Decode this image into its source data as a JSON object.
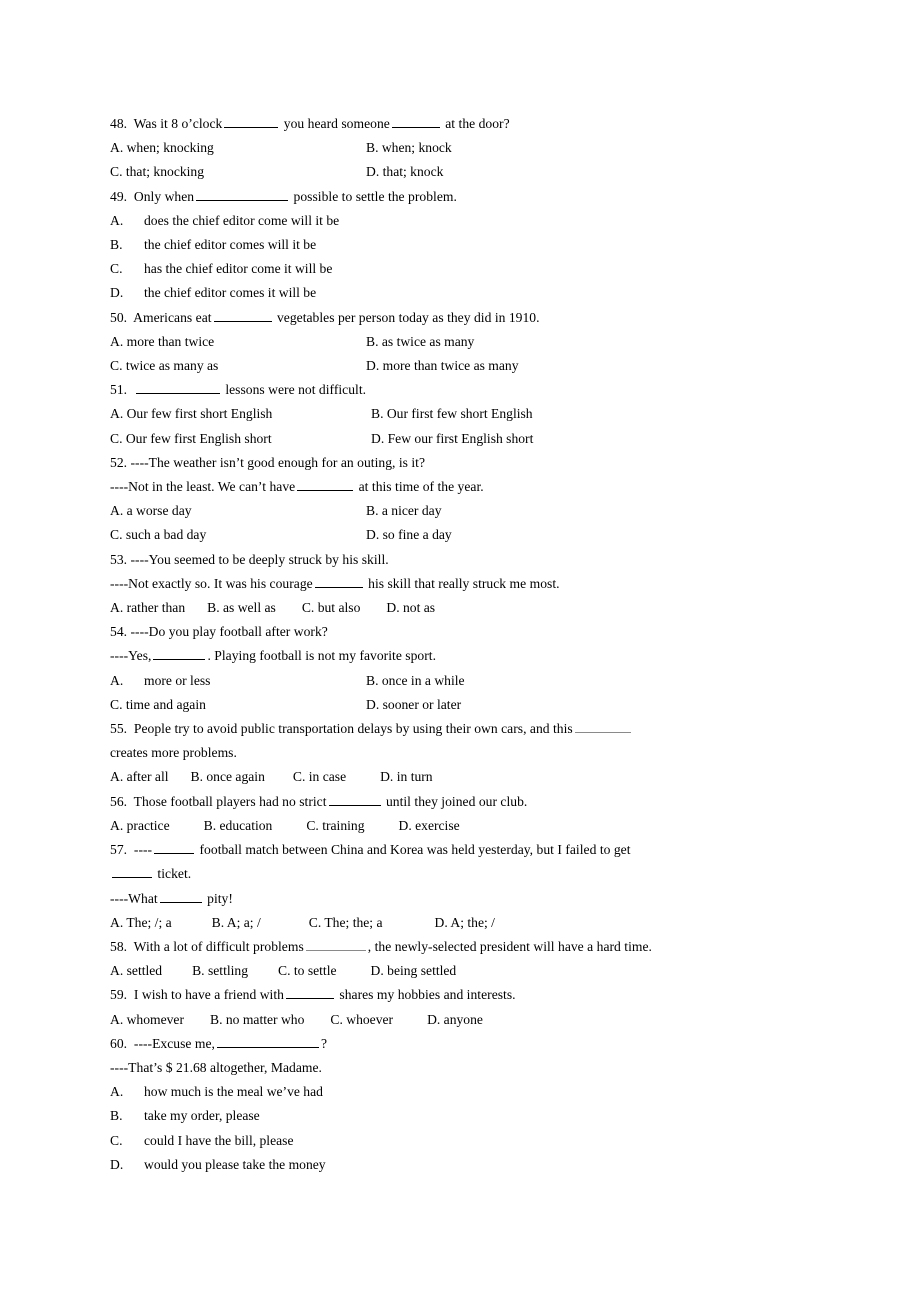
{
  "document": {
    "type": "english-grammar-multiple-choice-worksheet",
    "background_color": "#ffffff",
    "text_color": "#000000"
  },
  "questions": [
    {
      "number": "48.",
      "stem_parts": [
        "Was it 8 o’clock",
        "you heard someone",
        "at the door?"
      ],
      "stem_text": "48.  Was it 8 o’clock ______ you heard someone ______ at the door?",
      "options_layout": "two-column",
      "options": [
        "A. when; knocking",
        "B. when; knock",
        "C. that; knocking",
        "D. that; knock"
      ]
    },
    {
      "number": "49.",
      "stem_parts": [
        "Only when",
        "possible to settle the problem."
      ],
      "stem_text": "49.  Only when ____________ possible to settle the problem.",
      "options_layout": "stacked-indented",
      "options": [
        {
          "letter": "A.",
          "text": "does the chief editor come will it be"
        },
        {
          "letter": "B.",
          "text": "the chief editor comes will it be"
        },
        {
          "letter": "C.",
          "text": "has the chief editor come it will be"
        },
        {
          "letter": "D.",
          "text": "the chief editor comes it will be"
        }
      ]
    },
    {
      "number": "50.",
      "stem_parts": [
        "Americans eat",
        "vegetables per person today as they did in 1910."
      ],
      "stem_text": "50.  Americans eat ________ vegetables per person today as they did in 1910.",
      "options_layout": "two-column",
      "options": [
        "A. more than twice",
        "B. as twice as many",
        "C. twice as many as",
        "D. more than twice as many"
      ]
    },
    {
      "number": "51.",
      "stem_parts": [
        "",
        "lessons were not difficult."
      ],
      "stem_text": "51.  ___________ lessons were not difficult.",
      "options_layout": "two-column-narrow",
      "options": [
        "A. Our few first short English",
        "B. Our first few short English",
        "C. Our few first English short",
        "D. Few our first English short"
      ]
    },
    {
      "number": "52.",
      "stem_text": "52.  ----The weather isn’t good enough for an outing, is it?",
      "reply_parts": [
        "----Not in the least. We can’t have",
        "at this time of the year."
      ],
      "reply_text": "----Not in the least. We can’t have _______ at this time of the year.",
      "options_layout": "two-column",
      "options": [
        "A. a worse day",
        "B. a nicer day",
        "C. such a bad day",
        "D. so fine a day"
      ]
    },
    {
      "number": "53.",
      "stem_text": "53.  ----You seemed to be deeply struck by his skill.",
      "reply_parts": [
        "----Not exactly so. It was his courage",
        "his skill that really struck me most."
      ],
      "reply_text": "----Not exactly so. It was his courage ______ his skill that really struck me most.",
      "options_layout": "four-across",
      "options": [
        "A. rather than",
        "B. as well as",
        "C. but also",
        "D. not as"
      ]
    },
    {
      "number": "54.",
      "stem_text": "54.  ----Do you play football after work?",
      "reply_parts": [
        "----Yes,",
        ". Playing football is not my favorite sport."
      ],
      "reply_text": "----Yes, _______ . Playing football is not my favorite sport.",
      "options_layout": "two-column-indented-a",
      "options": [
        {
          "letter": "A.",
          "text": "more or less"
        },
        {
          "letter": "",
          "text": "B. once in a while"
        },
        {
          "letter": "",
          "text": "C. time and again"
        },
        {
          "letter": "",
          "text": "D. sooner or later"
        }
      ],
      "options_flat": [
        "A.    more or less",
        "B. once in a while",
        "C. time and again",
        "D. sooner or later"
      ]
    },
    {
      "number": "55.",
      "stem_parts": [
        "People try to avoid public transportation delays by using their own cars, and this",
        "creates more problems."
      ],
      "stem_text": "55.  People try to avoid public transportation delays by using their own cars, and this _______ creates more problems.",
      "continuation": "creates more problems.",
      "options_layout": "four-across",
      "options": [
        "A. after all",
        "B. once again",
        "C. in case",
        "D. in turn"
      ]
    },
    {
      "number": "56.",
      "stem_parts": [
        "Those football players had no strict",
        "until they joined our club."
      ],
      "stem_text": "56.  Those football players had no strict _______ until they joined our club.",
      "options_layout": "four-across",
      "options": [
        "A. practice",
        "B. education",
        "C. training",
        "D. exercise"
      ]
    },
    {
      "number": "57.",
      "stem_parts": [
        "----",
        "football match between China and Korea was held yesterday, but I failed to get",
        "ticket."
      ],
      "stem_text": "57.  ----_____ football match between China and Korea was held yesterday, but I failed to get _____ ticket.",
      "reply_parts": [
        "----What",
        "pity!"
      ],
      "reply_text": "----What _____ pity!",
      "options_layout": "four-across",
      "options": [
        "A. The; /; a",
        "B. A; a; /",
        "C. The; the; a",
        "D. A; the; /"
      ]
    },
    {
      "number": "58.",
      "stem_parts": [
        "With a lot of difficult problems",
        ", the newly-selected president will have a hard time."
      ],
      "stem_text": "58.  With a lot of difficult problems ________, the newly-selected president will have a hard time.",
      "options_layout": "four-across",
      "options": [
        "A. settled",
        "B. settling",
        "C. to settle",
        "D. being settled"
      ]
    },
    {
      "number": "59.",
      "stem_parts": [
        "I wish to have a friend with",
        "shares my hobbies and interests."
      ],
      "stem_text": "59.  I wish to have a friend with ______ shares my hobbies and interests.",
      "options_layout": "four-across",
      "options": [
        "A. whomever",
        "B. no matter who",
        "C. whoever",
        "D. anyone"
      ]
    },
    {
      "number": "60.",
      "stem_parts": [
        "----Excuse me,",
        "?"
      ],
      "stem_text": "60.  ----Excuse me, _____________?",
      "reply_text": "----That’s $ 21.68 altogether, Madame.",
      "options_layout": "stacked-indented",
      "options": [
        {
          "letter": "A.",
          "text": "how much is the meal we’ve had"
        },
        {
          "letter": "B.",
          "text": "take my order, please"
        },
        {
          "letter": "C.",
          "text": "could I have the bill, please"
        },
        {
          "letter": "D.",
          "text": "would you please take the money"
        }
      ]
    }
  ]
}
